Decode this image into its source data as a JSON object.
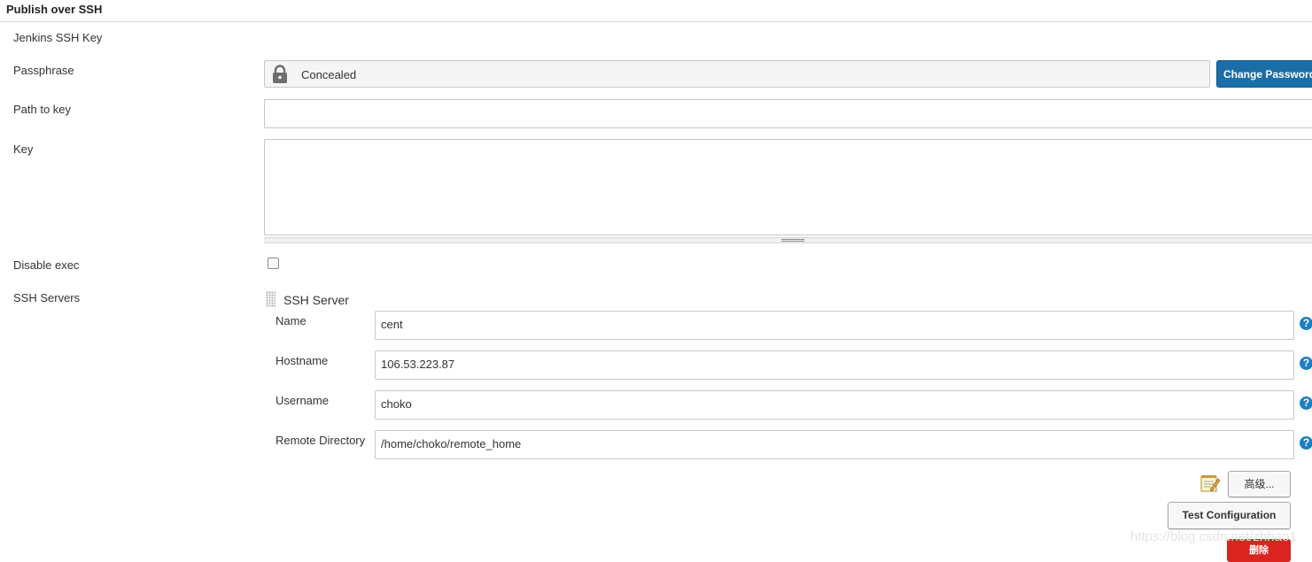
{
  "section": {
    "title": "Publish over SSH"
  },
  "labels": {
    "jenkins_ssh_key": "Jenkins SSH Key",
    "passphrase": "Passphrase",
    "path_to_key": "Path to key",
    "key": "Key",
    "disable_exec": "Disable exec",
    "ssh_servers": "SSH Servers"
  },
  "passphrase": {
    "value": "Concealed",
    "icon": "lock-icon",
    "button_label": "Change Password"
  },
  "path_to_key": {
    "value": ""
  },
  "key": {
    "value": ""
  },
  "disable_exec": {
    "checked": false
  },
  "ssh_server": {
    "header": "SSH Server",
    "fields": [
      {
        "label": "Name",
        "value": "cent"
      },
      {
        "label": "Hostname",
        "value": "106.53.223.87"
      },
      {
        "label": "Username",
        "value": "choko"
      },
      {
        "label": "Remote Directory",
        "value": "/home/choko/remote_home"
      }
    ],
    "help_glyph": "?",
    "advanced_label": "高级...",
    "test_label": "Test Configuration",
    "delete_label": "删除"
  },
  "watermark": "https://blog.csdn.net/zhhao1",
  "colors": {
    "primary": "#1b6ea8",
    "help": "#1b7fc4",
    "danger": "#d9241f"
  }
}
